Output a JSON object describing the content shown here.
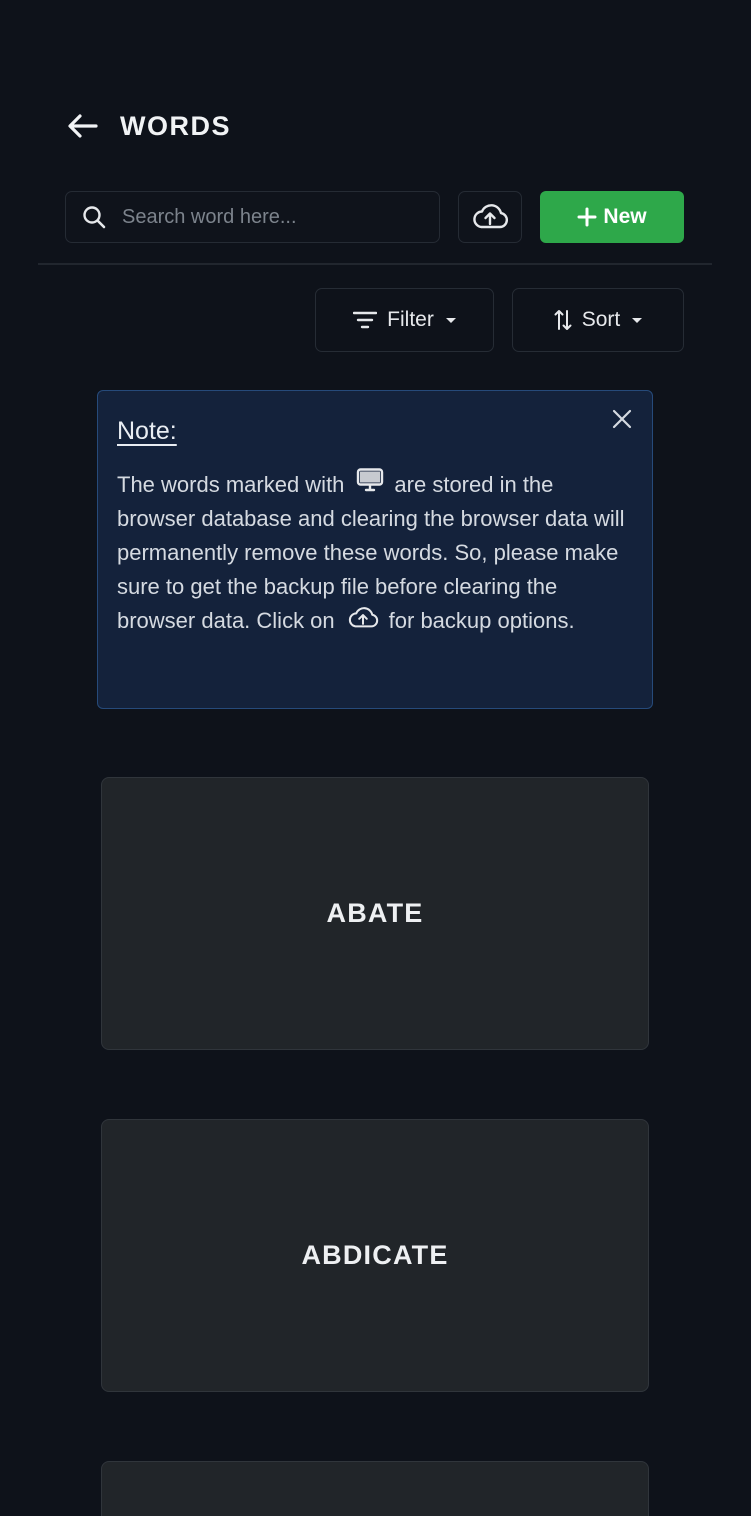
{
  "header": {
    "title": "WORDS"
  },
  "toolbar": {
    "search_placeholder": "Search word here...",
    "search_value": "",
    "new_label": "New"
  },
  "controls": {
    "filter_label": "Filter",
    "sort_label": "Sort"
  },
  "note": {
    "title": "Note:",
    "text_part1": "The words marked with",
    "text_part2": "are stored in the browser database and clearing the browser data will permanently remove these words. So, please make sure to get the backup file before clearing the browser data. Click on",
    "text_part3": "for backup options."
  },
  "words": [
    {
      "label": "ABATE"
    },
    {
      "label": "ABDICATE"
    },
    {
      "label": ""
    }
  ],
  "colors": {
    "background": "#0e121a",
    "accent_green": "#2ea84a",
    "note_background": "#14223b",
    "note_border": "#264a7a",
    "card_background": "#212529"
  }
}
